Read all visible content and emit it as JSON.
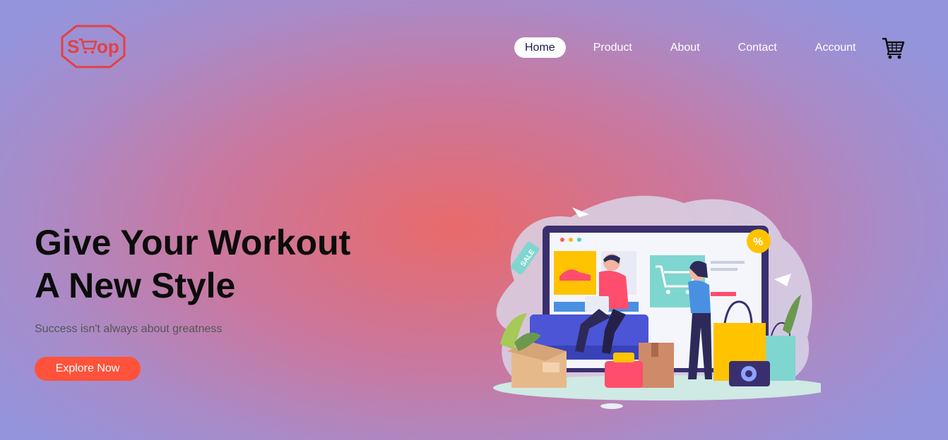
{
  "logo": {
    "text": "Soop",
    "color": "#e34143"
  },
  "nav": {
    "items": [
      {
        "label": "Home",
        "active": true
      },
      {
        "label": "Product",
        "active": false
      },
      {
        "label": "About",
        "active": false
      },
      {
        "label": "Contact",
        "active": false
      },
      {
        "label": "Account",
        "active": false
      }
    ],
    "cart_icon": "shopping-cart-icon"
  },
  "hero": {
    "title_line1": "Give Your Workout",
    "title_line2": "A New Style",
    "subtitle": "Success isn't always about greatness",
    "cta_label": "Explore Now",
    "cta_color": "#ff523b"
  },
  "illustration": {
    "sale_tag": "SALE",
    "percent_badge": "%"
  }
}
